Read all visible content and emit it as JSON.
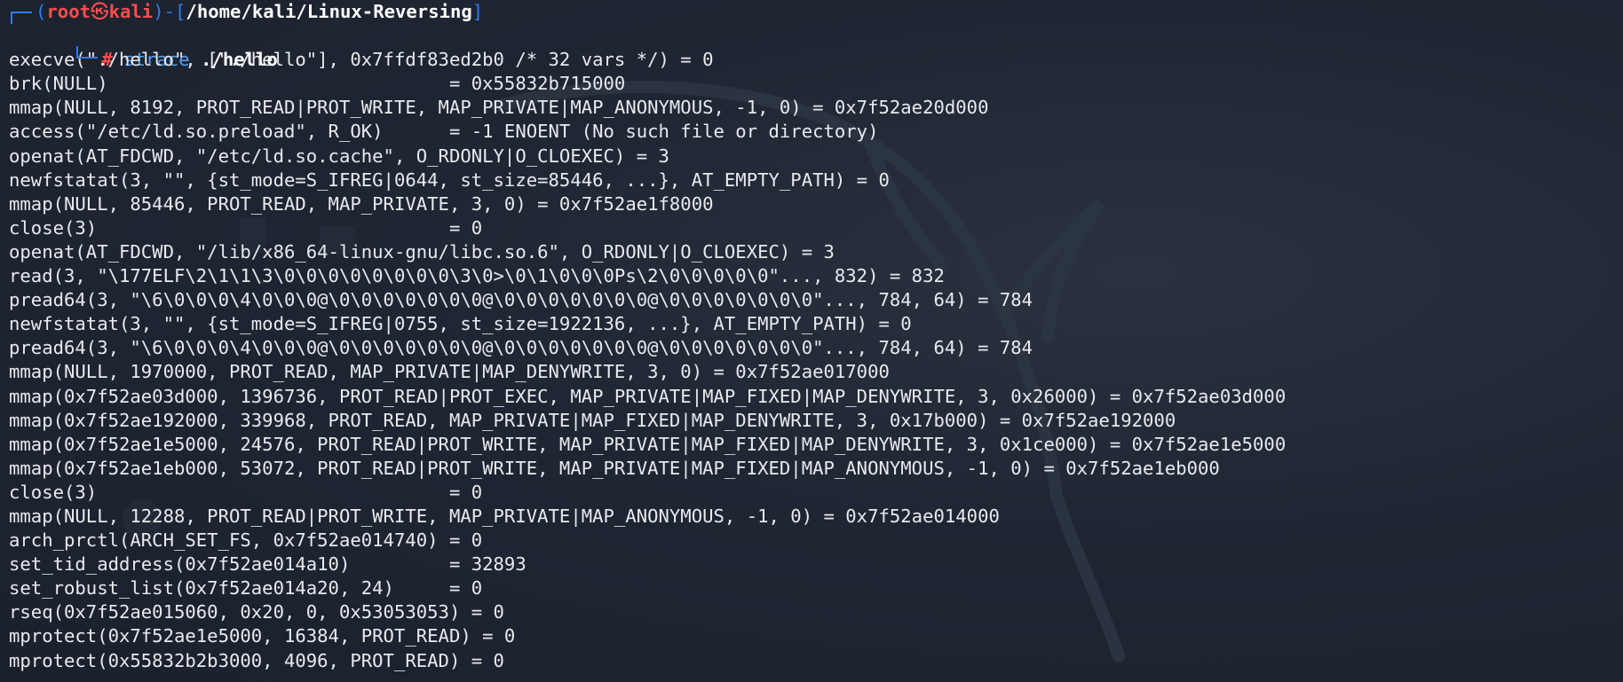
{
  "prompt": {
    "user": "root",
    "skull_icon": "skull-icon",
    "host": "kali",
    "dir": "/home/kali/Linux-Reversing",
    "hash": "#",
    "command": "strace",
    "argument": "./hello"
  },
  "output_lines": [
    "execve(\"./hello\", [\"./hello\"], 0x7ffdf83ed2b0 /* 32 vars */) = 0",
    "brk(NULL)                               = 0x55832b715000",
    "mmap(NULL, 8192, PROT_READ|PROT_WRITE, MAP_PRIVATE|MAP_ANONYMOUS, -1, 0) = 0x7f52ae20d000",
    "access(\"/etc/ld.so.preload\", R_OK)      = -1 ENOENT (No such file or directory)",
    "openat(AT_FDCWD, \"/etc/ld.so.cache\", O_RDONLY|O_CLOEXEC) = 3",
    "newfstatat(3, \"\", {st_mode=S_IFREG|0644, st_size=85446, ...}, AT_EMPTY_PATH) = 0",
    "mmap(NULL, 85446, PROT_READ, MAP_PRIVATE, 3, 0) = 0x7f52ae1f8000",
    "close(3)                                = 0",
    "openat(AT_FDCWD, \"/lib/x86_64-linux-gnu/libc.so.6\", O_RDONLY|O_CLOEXEC) = 3",
    "read(3, \"\\177ELF\\2\\1\\1\\3\\0\\0\\0\\0\\0\\0\\0\\0\\3\\0>\\0\\1\\0\\0\\0Ps\\2\\0\\0\\0\\0\\0\"..., 832) = 832",
    "pread64(3, \"\\6\\0\\0\\0\\4\\0\\0\\0@\\0\\0\\0\\0\\0\\0\\0@\\0\\0\\0\\0\\0\\0\\0@\\0\\0\\0\\0\\0\\0\\0\"..., 784, 64) = 784",
    "newfstatat(3, \"\", {st_mode=S_IFREG|0755, st_size=1922136, ...}, AT_EMPTY_PATH) = 0",
    "pread64(3, \"\\6\\0\\0\\0\\4\\0\\0\\0@\\0\\0\\0\\0\\0\\0\\0@\\0\\0\\0\\0\\0\\0\\0@\\0\\0\\0\\0\\0\\0\\0\"..., 784, 64) = 784",
    "mmap(NULL, 1970000, PROT_READ, MAP_PRIVATE|MAP_DENYWRITE, 3, 0) = 0x7f52ae017000",
    "mmap(0x7f52ae03d000, 1396736, PROT_READ|PROT_EXEC, MAP_PRIVATE|MAP_FIXED|MAP_DENYWRITE, 3, 0x26000) = 0x7f52ae03d000",
    "mmap(0x7f52ae192000, 339968, PROT_READ, MAP_PRIVATE|MAP_FIXED|MAP_DENYWRITE, 3, 0x17b000) = 0x7f52ae192000",
    "mmap(0x7f52ae1e5000, 24576, PROT_READ|PROT_WRITE, MAP_PRIVATE|MAP_FIXED|MAP_DENYWRITE, 3, 0x1ce000) = 0x7f52ae1e5000",
    "mmap(0x7f52ae1eb000, 53072, PROT_READ|PROT_WRITE, MAP_PRIVATE|MAP_FIXED|MAP_ANONYMOUS, -1, 0) = 0x7f52ae1eb000",
    "close(3)                                = 0",
    "mmap(NULL, 12288, PROT_READ|PROT_WRITE, MAP_PRIVATE|MAP_ANONYMOUS, -1, 0) = 0x7f52ae014000",
    "arch_prctl(ARCH_SET_FS, 0x7f52ae014740) = 0",
    "set_tid_address(0x7f52ae014a10)         = 32893",
    "set_robust_list(0x7f52ae014a20, 24)     = 0",
    "rseq(0x7f52ae015060, 0x20, 0, 0x53053053) = 0",
    "mprotect(0x7f52ae1e5000, 16384, PROT_READ) = 0",
    "mprotect(0x55832b2b3000, 4096, PROT_READ) = 0"
  ]
}
